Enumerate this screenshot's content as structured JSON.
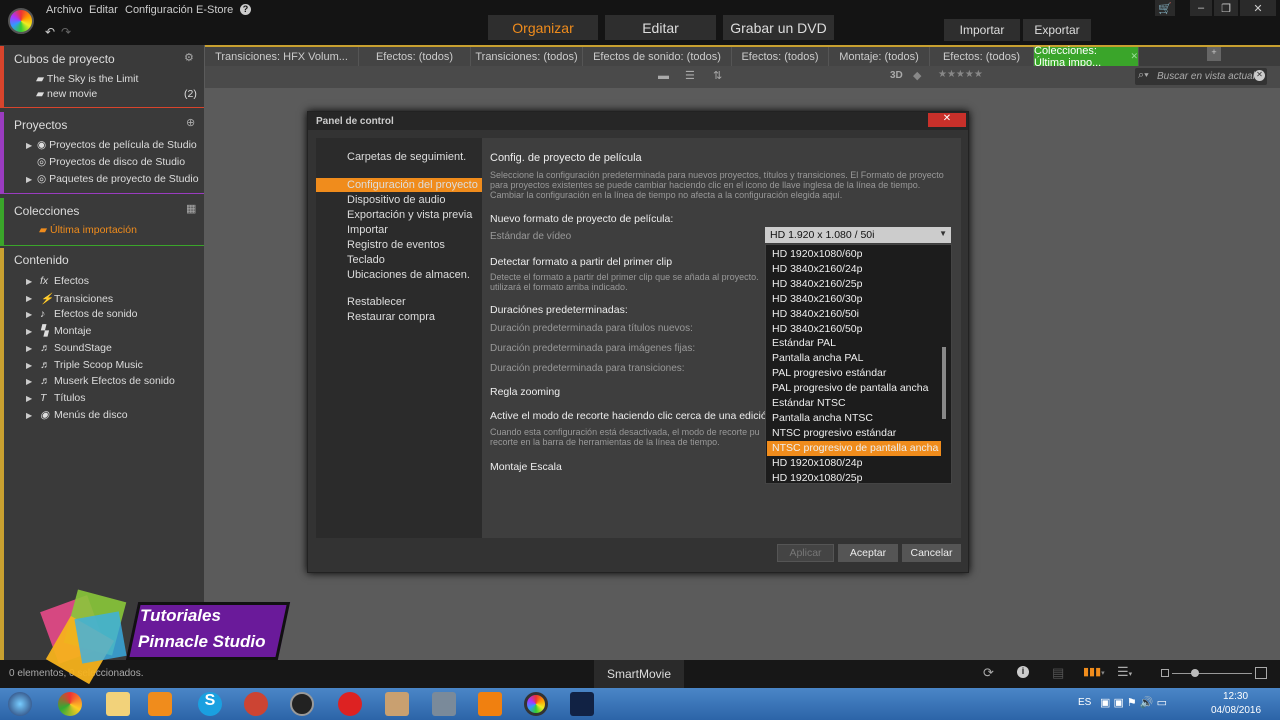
{
  "app": {
    "menu": [
      "Archivo",
      "Editar",
      "Configuración",
      "E-Store"
    ],
    "help_icon": "question-circle-icon"
  },
  "modes": {
    "organize": "Organizar",
    "edit": "Editar",
    "burn": "Grabar un DVD",
    "import": "Importar",
    "export": "Exportar"
  },
  "sidebar": {
    "cubos": {
      "title": "Cubos de proyecto",
      "items": [
        {
          "label": "The Sky is the Limit",
          "count": ""
        },
        {
          "label": "new movie",
          "count": "(2)"
        }
      ]
    },
    "proyectos": {
      "title": "Proyectos",
      "items": [
        "Proyectos de película de Studio",
        "Proyectos de disco de Studio",
        "Paquetes de proyecto de Studio"
      ]
    },
    "colecciones": {
      "title": "Colecciones",
      "items": [
        "Última importación"
      ]
    },
    "contenido": {
      "title": "Contenido",
      "items": [
        "Efectos",
        "Transiciones",
        "Efectos de sonido",
        "Montaje",
        "SoundStage",
        "Triple Scoop Music",
        "Muserk Efectos de sonido",
        "Títulos",
        "Menús de disco"
      ]
    }
  },
  "tabs": [
    "Transiciones: HFX Volum...",
    "Efectos: (todos)",
    "Transiciones: (todos)",
    "Efectos de sonido: (todos)",
    "Efectos: (todos)",
    "Montaje: (todos)",
    "Efectos: (todos)",
    "Colecciones: Última impo..."
  ],
  "toolbar": {
    "label_3d": "3D",
    "search_placeholder": "Buscar en vista actual"
  },
  "dialog": {
    "title": "Panel de control",
    "nav": [
      "Carpetas de seguimient.",
      "Configuración del proyecto",
      "Dispositivo de audio",
      "Exportación y vista previa",
      "Importar",
      "Registro de eventos",
      "Teclado",
      "Ubicaciones de almacen.",
      "Restablecer",
      "Restaurar compra"
    ],
    "nav_selected": 1,
    "heading": "Config. de proyecto de película",
    "desc": "Seleccione la configuración predeterminada para nuevos proyectos, títulos y transiciones. El Formato de proyecto para proyectos existentes se puede cambiar haciendo clic en el icono de llave inglesa de la línea de tiempo. Cambiar la configuración en la línea de tiempo no afecta a la configuración elegida aquí.",
    "new_format": "Nuevo formato de proyecto de película:",
    "video_std_label": "Estándar de vídeo",
    "video_std_value": "HD 1.920 x 1.080 / 50i",
    "detect": "Detectar formato a partir del primer clip",
    "detect_desc": "Detecte el formato a partir del primer clip que se añada al proyecto. utilizará el formato arriba indicado.",
    "durations": "Duraciónes predeterminadas:",
    "dur_titles": "Duración predeterminada para títulos nuevos:",
    "dur_images": "Duración predeterminada para imágenes fijas:",
    "dur_trans": "Duración predeterminada para transiciones:",
    "zoom_rule": "Regla zooming",
    "trim": "Active el modo de recorte haciendo clic cerca de una edición",
    "trim_desc": "Cuando esta configuración está desactivada, el modo de recorte pu recorte en la barra de herramientas de la línea de tiempo.",
    "montage": "Montaje Escala",
    "options": [
      "HD 1920x1080/60p",
      "HD 3840x2160/24p",
      "HD 3840x2160/25p",
      "HD 3840x2160/30p",
      "HD 3840x2160/50i",
      "HD 3840x2160/50p",
      "Estándar PAL",
      "Pantalla ancha PAL",
      "PAL progresivo estándar",
      "PAL progresivo de pantalla ancha",
      "Estándar NTSC",
      "Pantalla ancha NTSC",
      "NTSC progresivo estándar",
      "NTSC progresivo de pantalla ancha",
      "HD 1920x1080/24p",
      "HD 1920x1080/25p"
    ],
    "highlighted_option": 13,
    "apply": "Aplicar",
    "accept": "Aceptar",
    "cancel": "Cancelar"
  },
  "watermark": {
    "line1": "Tutoriales",
    "line2": "Pinnacle Studio"
  },
  "status": {
    "text": "0 elementos, 0 seleccionados.",
    "smartmovie": "SmartMovie"
  },
  "tray": {
    "lang": "ES",
    "time": "12:30",
    "date": "04/08/2016"
  },
  "colors": {
    "accent": "#f08c1c",
    "tab_active": "#3aa52a",
    "cubos": "#d8442c",
    "proyectos": "#9a3cc0",
    "colecciones": "#3aa52a",
    "contenido": "#c8a030"
  }
}
